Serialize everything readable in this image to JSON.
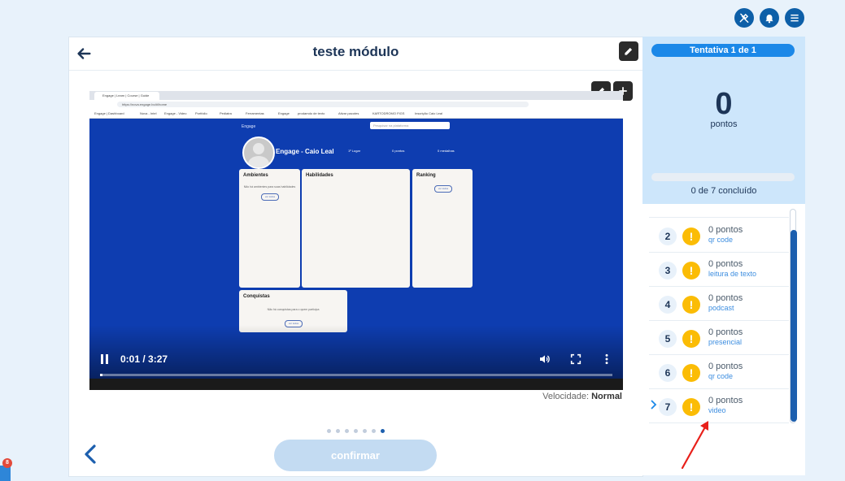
{
  "header": {
    "title": "teste módulo"
  },
  "icons": {
    "top_right": [
      "tools-icon",
      "bell-icon",
      "menu-icon"
    ],
    "header_back": "arrow-left-icon",
    "edit": "pencil-icon",
    "add": "plus-icon"
  },
  "colors": {
    "primary": "#0d5fa8",
    "accent": "#1b88e8",
    "warning": "#fbbc05",
    "video_bg": "#0e3db0",
    "side_top": "#cde6fb",
    "confirm_disabled": "#c3dbf2"
  },
  "video": {
    "time": "0:01 / 3:27",
    "progress_fraction": 0.005,
    "speed_label": "Velocidade:",
    "speed_value": "Normal",
    "screen": {
      "tab_title": "Engage | Learn | Course | Guide",
      "url": "https://nova.engage.bo/#/home",
      "bookmarks": [
        "Engage | Dashboard",
        "Nova - Intel",
        "Engage - Video",
        "Portfolio",
        "Pediatra",
        "Ferramentas",
        "Engage",
        "prodamdo de texto",
        "Ativar pacotes",
        "KARTODROMO FIGS",
        "Inscrição Caio Leal"
      ],
      "search_placeholder": "Pesquisar na plataforma",
      "user_name": "Engage - Caio Leal",
      "stats": [
        "1º Lugar",
        "0 pontos",
        "0 medalhas"
      ],
      "panels": {
        "ambientes": {
          "title": "Ambientes",
          "text": "Não há ambientes para suas habilidades",
          "button": "ver todos"
        },
        "habilidades": {
          "title": "Habilidades"
        },
        "ranking": {
          "title": "Ranking",
          "button": "ver todos"
        },
        "conquistas": {
          "title": "Conquistas",
          "text": "Não há conquistas para o quem participa",
          "button": "ver todos"
        }
      }
    }
  },
  "carousel": {
    "count": 7,
    "active_index": 6
  },
  "confirm_label": "confirmar",
  "sidebar": {
    "attempt": "Tentativa 1 de 1",
    "score": "0",
    "score_label": "pontos",
    "progress_fraction": 0,
    "completed": "0 de 7 concluído",
    "items": [
      {
        "num": "2",
        "points": "0 pontos",
        "type": "qr code"
      },
      {
        "num": "3",
        "points": "0 pontos",
        "type": "leitura de texto"
      },
      {
        "num": "4",
        "points": "0 pontos",
        "type": "podcast"
      },
      {
        "num": "5",
        "points": "0 pontos",
        "type": "presencial"
      },
      {
        "num": "6",
        "points": "0 pontos",
        "type": "qr code"
      },
      {
        "num": "7",
        "points": "0 pontos",
        "type": "video",
        "current": true
      }
    ]
  },
  "notification_count": "8"
}
